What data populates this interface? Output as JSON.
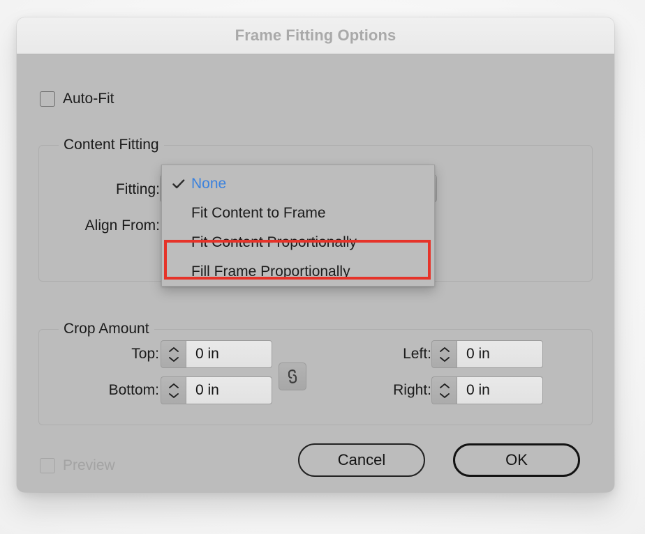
{
  "dialog": {
    "title": "Frame Fitting Options"
  },
  "auto_fit": {
    "label": "Auto-Fit",
    "checked": false
  },
  "content_fitting": {
    "legend": "Content Fitting",
    "fitting_label": "Fitting:",
    "fitting_value": "None",
    "align_from_label": "Align From:",
    "dropdown_open": true,
    "options": [
      {
        "label": "None",
        "selected": true,
        "checkmark": "✓"
      },
      {
        "label": "Fit Content to Frame",
        "selected": false,
        "checkmark": ""
      },
      {
        "label": "Fit Content Proportionally",
        "selected": false,
        "checkmark": ""
      },
      {
        "label": "Fill Frame Proportionally",
        "selected": false,
        "checkmark": ""
      }
    ],
    "highlighted_option": "Fit Content Proportionally"
  },
  "crop_amount": {
    "legend": "Crop Amount",
    "fields": [
      {
        "label": "Top:",
        "value": "0 in"
      },
      {
        "label": "Bottom:",
        "value": "0 in"
      },
      {
        "label": "Left:",
        "value": "0 in"
      },
      {
        "label": "Right:",
        "value": "0 in"
      }
    ],
    "link_icon": "chain-link-icon",
    "link_enabled": true
  },
  "footer": {
    "preview_label": "Preview",
    "preview_checked": false,
    "preview_disabled": true,
    "cancel_label": "Cancel",
    "ok_label": "OK"
  },
  "colors": {
    "dialog_bg": "#bcbcbc",
    "titlebar_bg": "#eeeeee",
    "title_text": "#a9a9a9",
    "accent_blue": "#3c82dd",
    "annotation_red": "#e63329",
    "field_bg": "#e6e6e6"
  },
  "annotation": {
    "type": "red-rectangle",
    "target": "Fit Content Proportionally"
  }
}
